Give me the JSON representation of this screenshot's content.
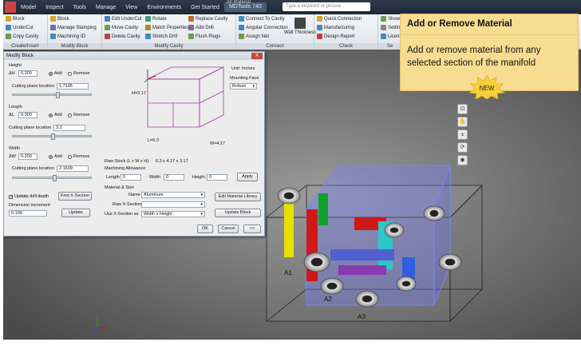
{
  "menu": {
    "file_btn": "",
    "items": [
      "Model",
      "Inspect",
      "Tools",
      "Manage",
      "View",
      "Environments",
      "Get Started",
      "MDTools 740"
    ],
    "active_index": 7,
    "doc_tab": "Alt Material",
    "search_placeholder": "Type a keyword or phrase"
  },
  "ribbon": {
    "groups": [
      {
        "label": "Create/Insert",
        "items": [
          "Block",
          "UnderCut",
          "Copy Cavity"
        ]
      },
      {
        "label": "Modify Block",
        "items": [
          "Block",
          "Manage Stamping",
          "Machining ID"
        ]
      },
      {
        "label": "Modify Cavity",
        "items": [
          "Edit UnderCut",
          "Rotate",
          "Replace Cavity",
          "Move Cavity",
          "Match Properties",
          "Add Drill",
          "Delete Cavity",
          "Stretch Drill",
          "Flush Plugs"
        ]
      },
      {
        "label": "Connect",
        "items": [
          "Connect To Cavity",
          "Angular Connection",
          "Assign Net",
          "Wall Thickness"
        ]
      },
      {
        "label": "Check",
        "items": [
          "Quick Connection",
          "Manufacturing",
          "Design Report"
        ]
      },
      {
        "label": "Se",
        "items": [
          "Show/H",
          "Settings",
          "License"
        ]
      }
    ]
  },
  "dialog": {
    "title": "Modify Block",
    "close": "X",
    "height": {
      "label": "Height",
      "delta_label": "ΔH",
      "delta": "0.200",
      "add": "Add",
      "remove": "Remove",
      "cut_label": "Cutting plane location",
      "cut": "1.7105"
    },
    "length": {
      "label": "Length",
      "delta_label": "ΔL",
      "delta": "0.300",
      "add": "Add",
      "remove": "Remove",
      "cut_label": "Cutting plane location",
      "cut": "3.2"
    },
    "width": {
      "label": "Width",
      "delta_label": "ΔW",
      "delta": "0.200",
      "add": "Add",
      "remove": "Remove",
      "cut_label": "Cutting plane location",
      "cut": "2.1609"
    },
    "update_drill": "Update drill depth",
    "find_xsection": "Find X-Section",
    "dim_inc_label": "Dimension increment",
    "dim_inc": "0.100",
    "update": "Update",
    "preview": {
      "h": "H=3.17",
      "l": "L=6.3",
      "w": "W=4.17"
    },
    "unit_label": "Unit:",
    "unit_value": "Inches",
    "mounting_face_label": "Mounting Face",
    "mounting_face": "Bottom",
    "raw_stock_label": "Raw Stock (L x W x H):",
    "raw_stock_value": "6.3 x 4.17 x 3.17",
    "allowance_label": "Machining Allowance",
    "length_label": "Length",
    "length_val": "0",
    "width_label": "Width",
    "width_val": "0",
    "height_label": "Height",
    "height_val": "0",
    "apply": "Apply",
    "material_section": "Material & Size",
    "name_label": "Name",
    "name_value": "Aluminum",
    "raw_xsection_label": "Raw X-Section",
    "use_xsection_label": "Use X-Section as",
    "use_xsection_value": "Width x Height",
    "edit_library": "Edit Material Library",
    "update_block": "Update Block",
    "ok": "OK",
    "cancel": "Cancel",
    "collapse": "<<"
  },
  "viewport": {
    "labels": [
      "A1",
      "A2",
      "A3"
    ]
  },
  "callout": {
    "title": "Add or Remove Material",
    "body": "Add or remove material from any selected section of the manifold",
    "badge": "NEW"
  },
  "colors": {
    "callout_bg": "#f7dc92",
    "badge": "#f5cf3c",
    "viewport_bg": "#5c5c5c"
  }
}
